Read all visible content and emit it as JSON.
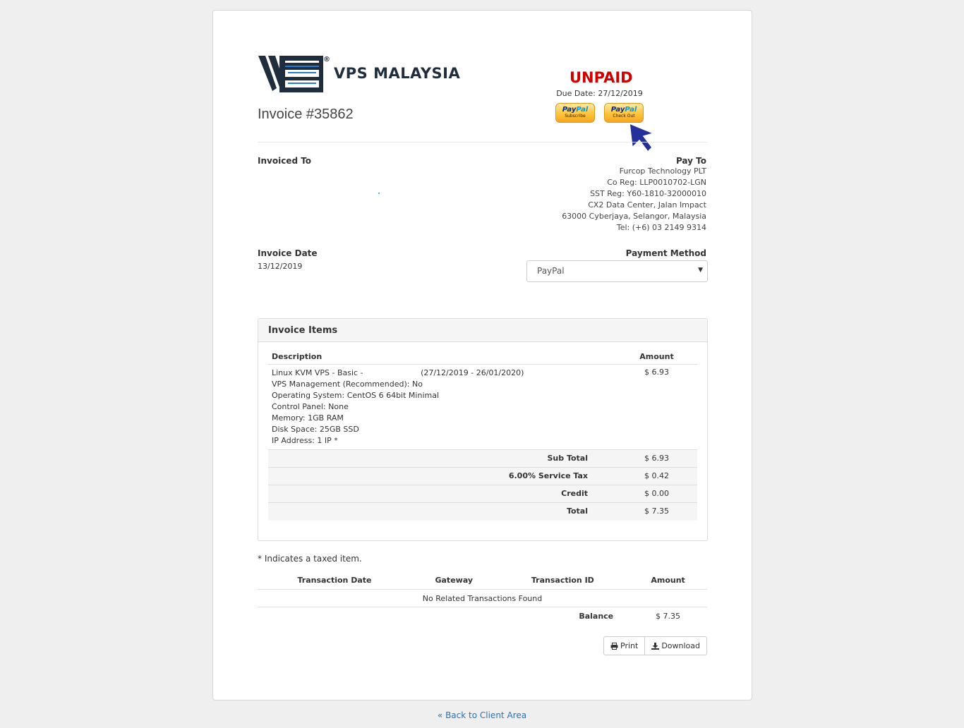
{
  "brand": {
    "name": "VPS MALAYSIA",
    "registered_mark": "®",
    "primary_color": "#1f2d3d",
    "accent_color": "#2a7bd4"
  },
  "invoice": {
    "title": "Invoice #35862",
    "status": "UNPAID",
    "status_color": "#cc0000",
    "due_date": "Due Date: 27/12/2019"
  },
  "paypal_buttons": [
    {
      "logo_a": "Pay",
      "logo_b": "Pal",
      "sub": "Subscribe"
    },
    {
      "logo_a": "Pay",
      "logo_b": "Pal",
      "sub": "Check Out"
    }
  ],
  "invoiced_to": {
    "label": "Invoiced To"
  },
  "pay_to": {
    "label": "Pay To",
    "lines": [
      "Furcop Technology PLT",
      "Co Reg: LLP0010702-LGN",
      "SST Reg: Y60-1810-32000010",
      "CX2 Data Center, Jalan Impact",
      "63000 Cyberjaya, Selangor, Malaysia",
      "Tel: (+6) 03 2149 9314"
    ]
  },
  "invoice_date": {
    "label": "Invoice Date",
    "value": "13/12/2019"
  },
  "payment_method": {
    "label": "Payment Method",
    "selected": "PayPal"
  },
  "items_panel": {
    "title": "Invoice Items",
    "col_description": "Description",
    "col_amount": "Amount",
    "item": {
      "name": "Linux KVM VPS - Basic -",
      "period": "(27/12/2019 - 26/01/2020)",
      "details": [
        "VPS Management (Recommended): No",
        "Operating System: CentOS 6 64bit Minimal",
        "Control Panel: None",
        "Memory: 1GB RAM",
        "Disk Space: 25GB SSD",
        "IP Address: 1 IP *"
      ],
      "amount": "$ 6.93"
    },
    "totals": [
      {
        "label": "Sub Total",
        "value": "$ 6.93"
      },
      {
        "label": "6.00% Service Tax",
        "value": "$ 0.42"
      },
      {
        "label": "Credit",
        "value": "$ 0.00"
      },
      {
        "label": "Total",
        "value": "$ 7.35"
      }
    ]
  },
  "tax_note": "* Indicates a taxed item.",
  "transactions": {
    "headers": [
      "Transaction Date",
      "Gateway",
      "Transaction ID",
      "Amount"
    ],
    "empty_message": "No Related Transactions Found",
    "balance_label": "Balance",
    "balance_value": "$ 7.35"
  },
  "actions": {
    "print": "Print",
    "download": "Download"
  },
  "footer": {
    "back_link": "« Back to Client Area"
  }
}
